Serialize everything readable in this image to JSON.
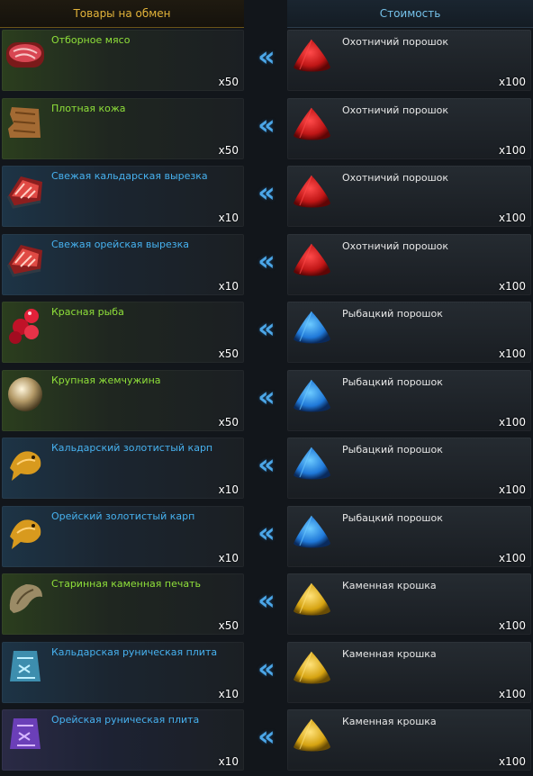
{
  "header": {
    "left_title": "Товары на обмен",
    "right_title": "Стоимость"
  },
  "arrow_glyph": "«",
  "rows": [
    {
      "item": {
        "name": "Отборное мясо",
        "qty": "x50",
        "rarity": "green",
        "icon": "raw-steak-icon"
      },
      "cost": {
        "name": "Охотничий порошок",
        "qty": "x100",
        "color": "red",
        "icon": "red-powder-icon"
      }
    },
    {
      "item": {
        "name": "Плотная кожа",
        "qty": "x50",
        "rarity": "green",
        "icon": "leather-hide-icon"
      },
      "cost": {
        "name": "Охотничий порошок",
        "qty": "x100",
        "color": "red",
        "icon": "red-powder-icon"
      }
    },
    {
      "item": {
        "name": "Свежая кальдарская вырезка",
        "qty": "x10",
        "rarity": "blue",
        "icon": "fresh-cut-meat-icon"
      },
      "cost": {
        "name": "Охотничий порошок",
        "qty": "x100",
        "color": "red",
        "icon": "red-powder-icon"
      }
    },
    {
      "item": {
        "name": "Свежая орейская вырезка",
        "qty": "x10",
        "rarity": "blue",
        "icon": "fresh-cut-meat-icon"
      },
      "cost": {
        "name": "Охотничий порошок",
        "qty": "x100",
        "color": "red",
        "icon": "red-powder-icon"
      }
    },
    {
      "item": {
        "name": "Красная рыба",
        "qty": "x50",
        "rarity": "green",
        "icon": "red-fish-icon"
      },
      "cost": {
        "name": "Рыбацкий порошок",
        "qty": "x100",
        "color": "blue",
        "icon": "blue-powder-icon"
      }
    },
    {
      "item": {
        "name": "Крупная жемчужина",
        "qty": "x50",
        "rarity": "green",
        "icon": "pearl-icon"
      },
      "cost": {
        "name": "Рыбацкий порошок",
        "qty": "x100",
        "color": "blue",
        "icon": "blue-powder-icon"
      }
    },
    {
      "item": {
        "name": "Кальдарский золотистый карп",
        "qty": "x10",
        "rarity": "blue",
        "icon": "golden-carp-icon"
      },
      "cost": {
        "name": "Рыбацкий порошок",
        "qty": "x100",
        "color": "blue",
        "icon": "blue-powder-icon"
      }
    },
    {
      "item": {
        "name": "Орейский золотистый карп",
        "qty": "x10",
        "rarity": "blue",
        "icon": "golden-carp-icon"
      },
      "cost": {
        "name": "Рыбацкий порошок",
        "qty": "x100",
        "color": "blue",
        "icon": "blue-powder-icon"
      }
    },
    {
      "item": {
        "name": "Старинная каменная печать",
        "qty": "x50",
        "rarity": "green",
        "icon": "stone-seal-icon"
      },
      "cost": {
        "name": "Каменная крошка",
        "qty": "x100",
        "color": "gold",
        "icon": "gold-powder-icon"
      }
    },
    {
      "item": {
        "name": "Кальдарская руническая плита",
        "qty": "x10",
        "rarity": "blue",
        "icon": "rune-tablet-icon"
      },
      "cost": {
        "name": "Каменная крошка",
        "qty": "x100",
        "color": "gold",
        "icon": "gold-powder-icon"
      }
    },
    {
      "item": {
        "name": "Орейская руническая плита",
        "qty": "x10",
        "rarity": "blue",
        "icon": "rune-tablet-icon"
      },
      "cost": {
        "name": "Каменная крошка",
        "qty": "x100",
        "color": "gold",
        "icon": "gold-powder-icon"
      }
    }
  ]
}
